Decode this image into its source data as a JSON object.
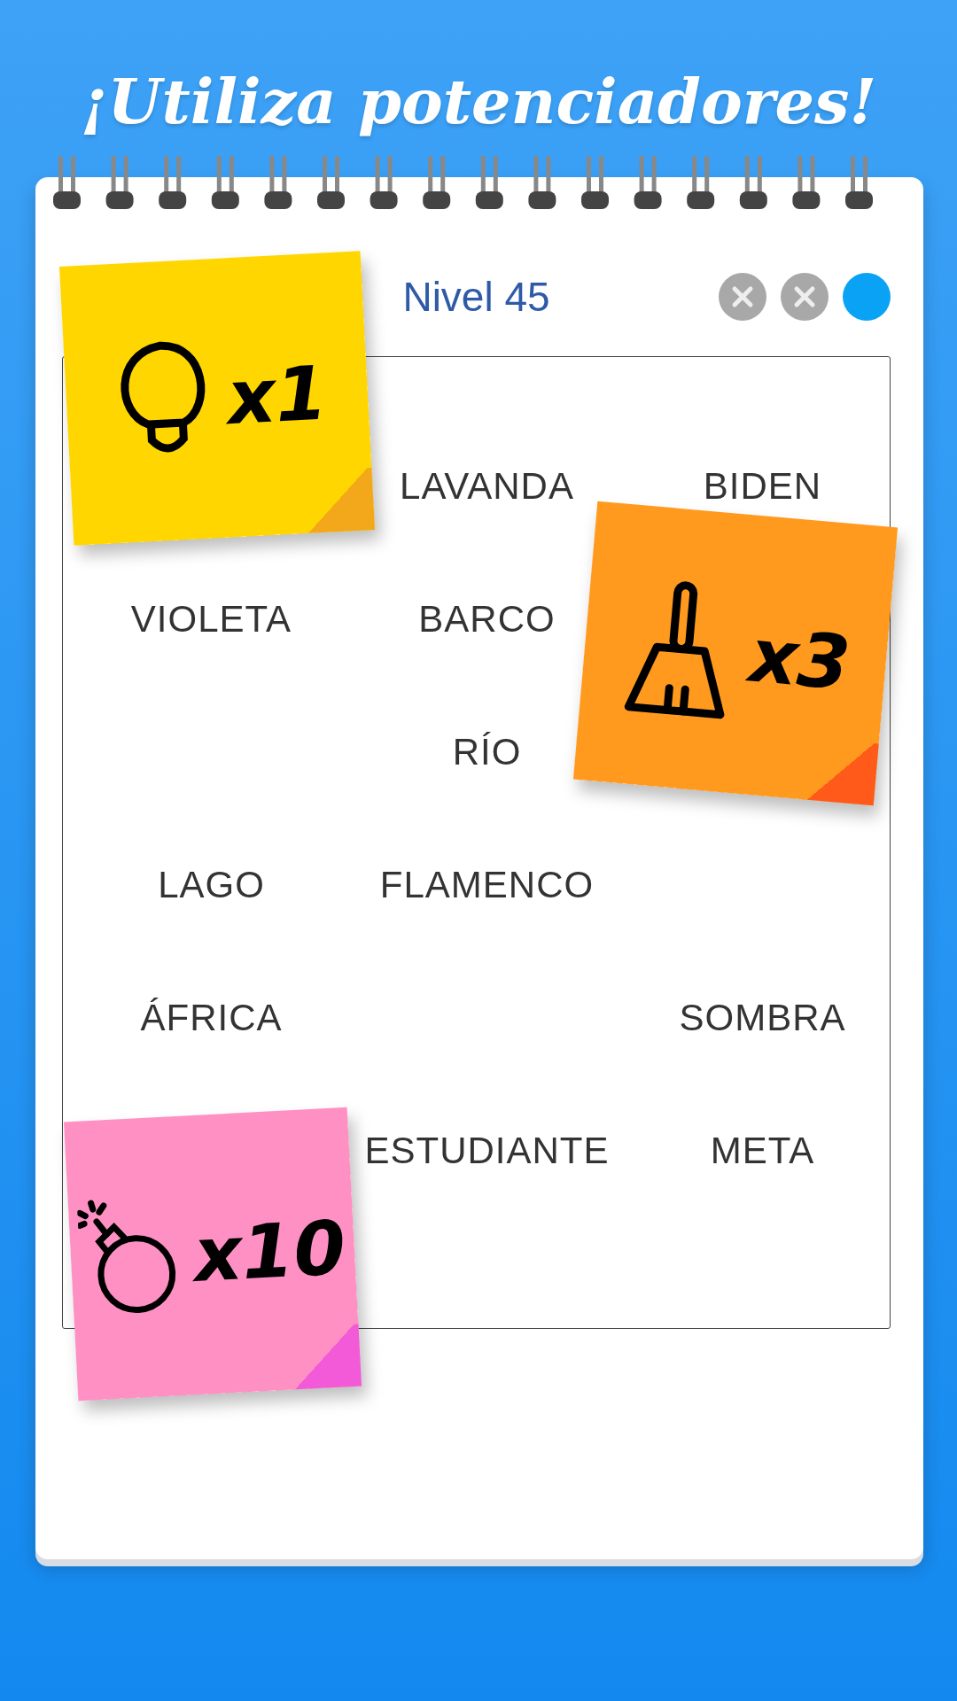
{
  "headline": "¡Utiliza potenciadores!",
  "level_title": "Nivel 45",
  "mistakes": [
    {
      "used": true
    },
    {
      "used": true
    },
    {
      "used": false
    }
  ],
  "board": {
    "rows": [
      [
        null,
        "LAVANDA",
        "BIDEN"
      ],
      [
        "VIOLETA",
        "BARCO",
        null
      ],
      [
        null,
        "RÍO",
        null
      ],
      [
        "LAGO",
        "FLAMENCO",
        null
      ],
      [
        "ÁFRICA",
        null,
        "SOMBRA"
      ],
      [
        null,
        "ESTUDIANTE",
        "META"
      ]
    ]
  },
  "powerups": [
    {
      "kind": "hint",
      "count": "x1",
      "color": "#ffd600"
    },
    {
      "kind": "broom",
      "count": "x3",
      "color": "#ff9a1f"
    },
    {
      "kind": "bomb",
      "count": "x10",
      "color": "#ff90c4"
    }
  ]
}
